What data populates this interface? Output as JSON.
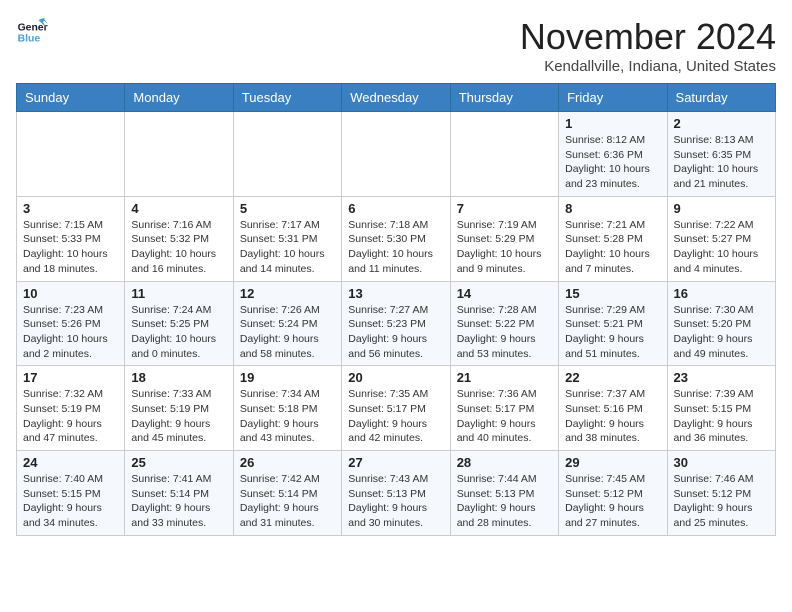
{
  "header": {
    "logo_general": "General",
    "logo_blue": "Blue",
    "month_title": "November 2024",
    "location": "Kendallville, Indiana, United States"
  },
  "weekdays": [
    "Sunday",
    "Monday",
    "Tuesday",
    "Wednesday",
    "Thursday",
    "Friday",
    "Saturday"
  ],
  "weeks": [
    [
      {
        "day": "",
        "info": ""
      },
      {
        "day": "",
        "info": ""
      },
      {
        "day": "",
        "info": ""
      },
      {
        "day": "",
        "info": ""
      },
      {
        "day": "",
        "info": ""
      },
      {
        "day": "1",
        "info": "Sunrise: 8:12 AM\nSunset: 6:36 PM\nDaylight: 10 hours\nand 23 minutes."
      },
      {
        "day": "2",
        "info": "Sunrise: 8:13 AM\nSunset: 6:35 PM\nDaylight: 10 hours\nand 21 minutes."
      }
    ],
    [
      {
        "day": "3",
        "info": "Sunrise: 7:15 AM\nSunset: 5:33 PM\nDaylight: 10 hours\nand 18 minutes."
      },
      {
        "day": "4",
        "info": "Sunrise: 7:16 AM\nSunset: 5:32 PM\nDaylight: 10 hours\nand 16 minutes."
      },
      {
        "day": "5",
        "info": "Sunrise: 7:17 AM\nSunset: 5:31 PM\nDaylight: 10 hours\nand 14 minutes."
      },
      {
        "day": "6",
        "info": "Sunrise: 7:18 AM\nSunset: 5:30 PM\nDaylight: 10 hours\nand 11 minutes."
      },
      {
        "day": "7",
        "info": "Sunrise: 7:19 AM\nSunset: 5:29 PM\nDaylight: 10 hours\nand 9 minutes."
      },
      {
        "day": "8",
        "info": "Sunrise: 7:21 AM\nSunset: 5:28 PM\nDaylight: 10 hours\nand 7 minutes."
      },
      {
        "day": "9",
        "info": "Sunrise: 7:22 AM\nSunset: 5:27 PM\nDaylight: 10 hours\nand 4 minutes."
      }
    ],
    [
      {
        "day": "10",
        "info": "Sunrise: 7:23 AM\nSunset: 5:26 PM\nDaylight: 10 hours\nand 2 minutes."
      },
      {
        "day": "11",
        "info": "Sunrise: 7:24 AM\nSunset: 5:25 PM\nDaylight: 10 hours\nand 0 minutes."
      },
      {
        "day": "12",
        "info": "Sunrise: 7:26 AM\nSunset: 5:24 PM\nDaylight: 9 hours\nand 58 minutes."
      },
      {
        "day": "13",
        "info": "Sunrise: 7:27 AM\nSunset: 5:23 PM\nDaylight: 9 hours\nand 56 minutes."
      },
      {
        "day": "14",
        "info": "Sunrise: 7:28 AM\nSunset: 5:22 PM\nDaylight: 9 hours\nand 53 minutes."
      },
      {
        "day": "15",
        "info": "Sunrise: 7:29 AM\nSunset: 5:21 PM\nDaylight: 9 hours\nand 51 minutes."
      },
      {
        "day": "16",
        "info": "Sunrise: 7:30 AM\nSunset: 5:20 PM\nDaylight: 9 hours\nand 49 minutes."
      }
    ],
    [
      {
        "day": "17",
        "info": "Sunrise: 7:32 AM\nSunset: 5:19 PM\nDaylight: 9 hours\nand 47 minutes."
      },
      {
        "day": "18",
        "info": "Sunrise: 7:33 AM\nSunset: 5:19 PM\nDaylight: 9 hours\nand 45 minutes."
      },
      {
        "day": "19",
        "info": "Sunrise: 7:34 AM\nSunset: 5:18 PM\nDaylight: 9 hours\nand 43 minutes."
      },
      {
        "day": "20",
        "info": "Sunrise: 7:35 AM\nSunset: 5:17 PM\nDaylight: 9 hours\nand 42 minutes."
      },
      {
        "day": "21",
        "info": "Sunrise: 7:36 AM\nSunset: 5:17 PM\nDaylight: 9 hours\nand 40 minutes."
      },
      {
        "day": "22",
        "info": "Sunrise: 7:37 AM\nSunset: 5:16 PM\nDaylight: 9 hours\nand 38 minutes."
      },
      {
        "day": "23",
        "info": "Sunrise: 7:39 AM\nSunset: 5:15 PM\nDaylight: 9 hours\nand 36 minutes."
      }
    ],
    [
      {
        "day": "24",
        "info": "Sunrise: 7:40 AM\nSunset: 5:15 PM\nDaylight: 9 hours\nand 34 minutes."
      },
      {
        "day": "25",
        "info": "Sunrise: 7:41 AM\nSunset: 5:14 PM\nDaylight: 9 hours\nand 33 minutes."
      },
      {
        "day": "26",
        "info": "Sunrise: 7:42 AM\nSunset: 5:14 PM\nDaylight: 9 hours\nand 31 minutes."
      },
      {
        "day": "27",
        "info": "Sunrise: 7:43 AM\nSunset: 5:13 PM\nDaylight: 9 hours\nand 30 minutes."
      },
      {
        "day": "28",
        "info": "Sunrise: 7:44 AM\nSunset: 5:13 PM\nDaylight: 9 hours\nand 28 minutes."
      },
      {
        "day": "29",
        "info": "Sunrise: 7:45 AM\nSunset: 5:12 PM\nDaylight: 9 hours\nand 27 minutes."
      },
      {
        "day": "30",
        "info": "Sunrise: 7:46 AM\nSunset: 5:12 PM\nDaylight: 9 hours\nand 25 minutes."
      }
    ]
  ]
}
